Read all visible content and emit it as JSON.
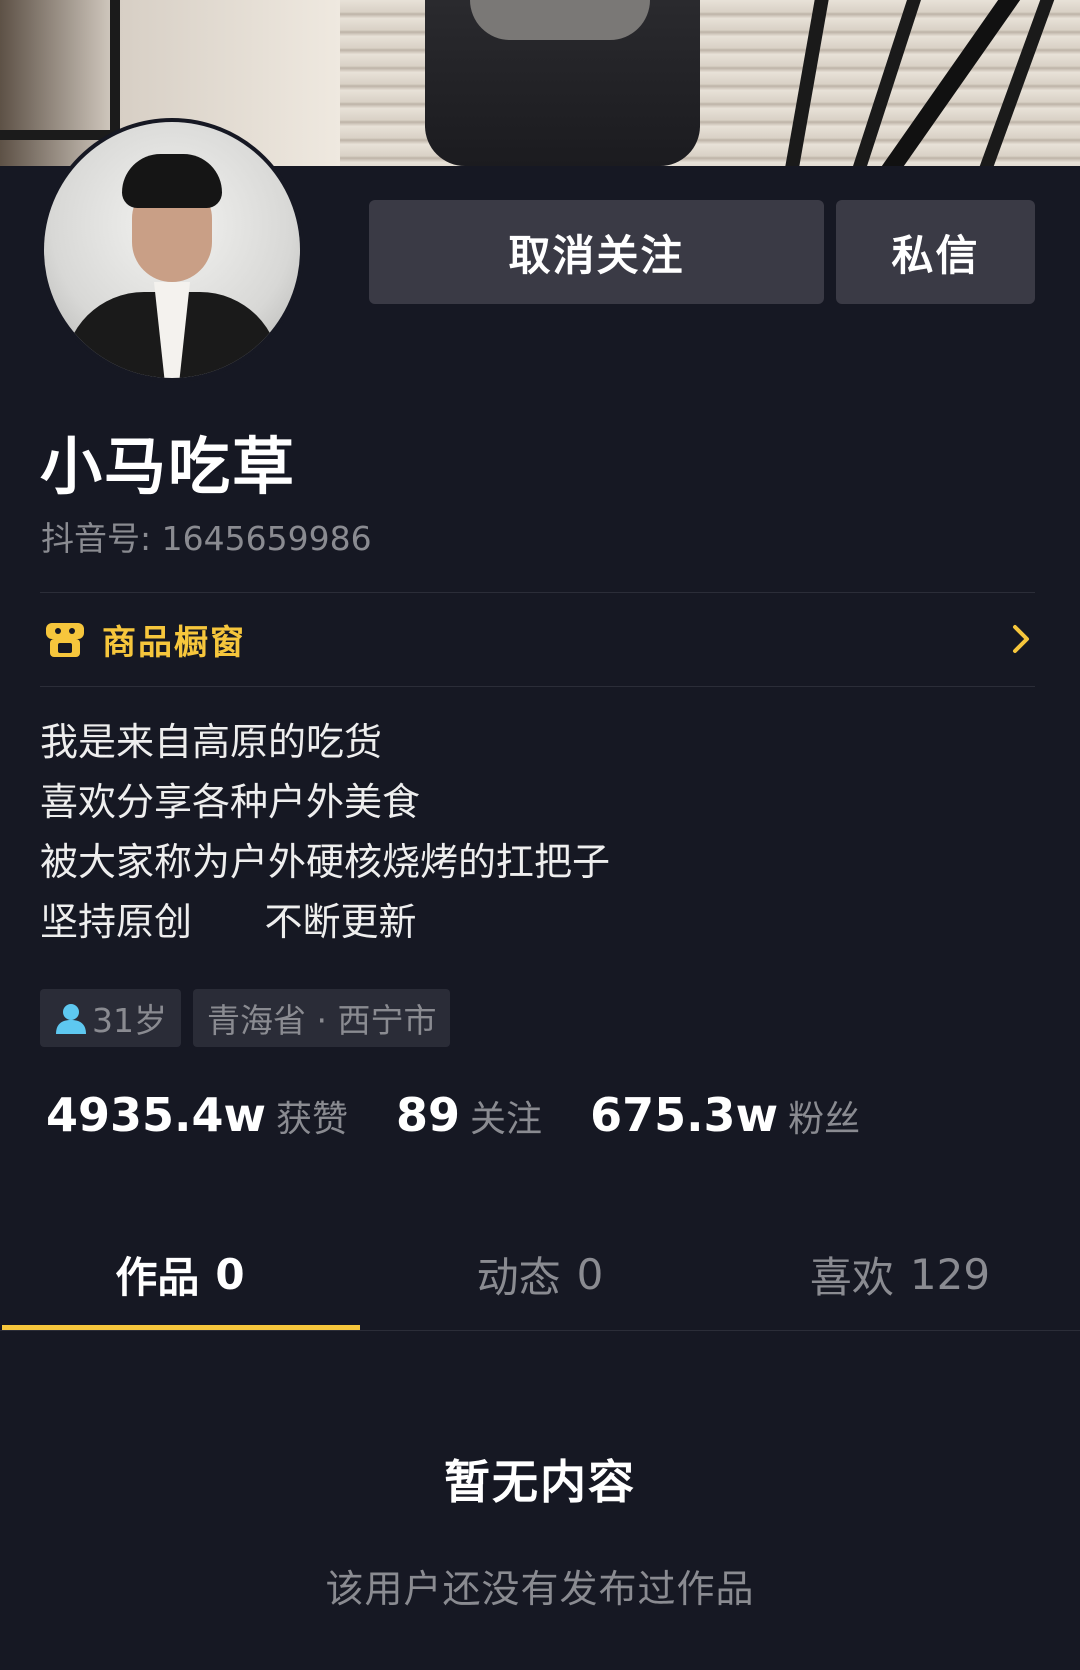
{
  "profile": {
    "nickname": "小马吃草",
    "douyin_id": "抖音号: 1645659986"
  },
  "actions": {
    "unfollow_label": "取消关注",
    "message_label": "私信"
  },
  "shop": {
    "label": "商品橱窗",
    "icon": "shop-icon",
    "accent_color": "#F6C63C"
  },
  "bio": {
    "lines": [
      "我是来自高原的吃货",
      "喜欢分享各种户外美食",
      "被大家称为户外硬核烧烤的扛把子",
      "坚持原创      不断更新"
    ]
  },
  "tags": {
    "age": "31岁",
    "location": "青海省 · 西宁市"
  },
  "stats": [
    {
      "value": "4935.4w",
      "label": "获赞"
    },
    {
      "value": "89",
      "label": "关注"
    },
    {
      "value": "675.3w",
      "label": "粉丝"
    }
  ],
  "tabs": [
    {
      "label": "作品",
      "count": "0",
      "active": true
    },
    {
      "label": "动态",
      "count": "0",
      "active": false
    },
    {
      "label": "喜欢",
      "count": "129",
      "active": false
    }
  ],
  "empty_state": {
    "title": "暂无内容",
    "subtitle": "该用户还没有发布过作品"
  },
  "colors": {
    "background": "#161823",
    "button": "#3A3A45",
    "muted_text": "#8A8B91",
    "accent": "#F6C63C",
    "person_icon": "#5EC8F0"
  }
}
